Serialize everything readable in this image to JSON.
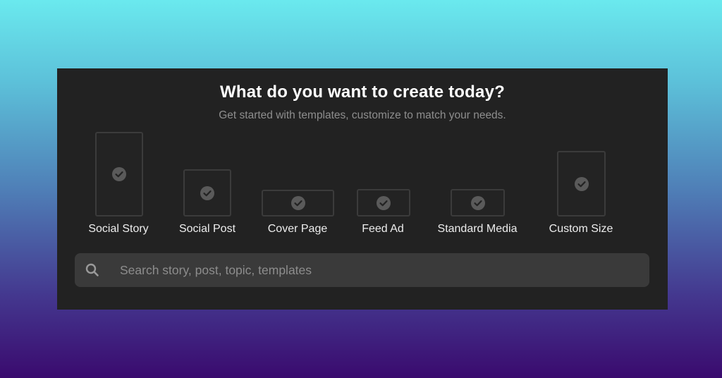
{
  "header": {
    "title": "What do you want to create today?",
    "subtitle": "Get started with templates, customize to match your needs."
  },
  "formats": [
    {
      "label": "Social Story",
      "icon": "check-icon"
    },
    {
      "label": "Social Post",
      "icon": "check-icon"
    },
    {
      "label": "Cover Page",
      "icon": "check-icon"
    },
    {
      "label": "Feed Ad",
      "icon": "check-icon"
    },
    {
      "label": "Standard Media",
      "icon": "check-icon"
    },
    {
      "label": "Custom Size",
      "icon": "check-icon"
    }
  ],
  "search": {
    "placeholder": "Search story, post, topic, templates",
    "icon": "search-icon"
  },
  "colors": {
    "panel_bg": "#222222",
    "shape_border": "#3b3b3b",
    "check": "#5a5a5a",
    "search_bg": "#3a3a3a"
  }
}
